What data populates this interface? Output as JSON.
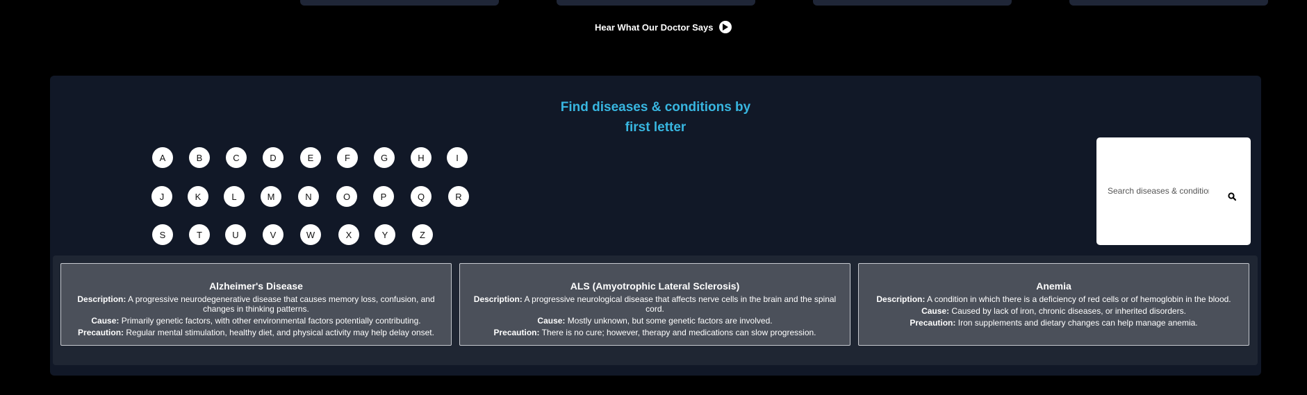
{
  "doctor_link": {
    "label": "Hear What Our Doctor Says",
    "icon": "play-icon"
  },
  "finder": {
    "heading_line1": "Find diseases & conditions by",
    "heading_line2": "first letter",
    "letters": [
      "A",
      "B",
      "C",
      "D",
      "E",
      "F",
      "G",
      "H",
      "I",
      "J",
      "K",
      "L",
      "M",
      "N",
      "O",
      "P",
      "Q",
      "R",
      "S",
      "T",
      "U",
      "V",
      "W",
      "X",
      "Y",
      "Z"
    ]
  },
  "search": {
    "placeholder": "Search diseases & conditions",
    "icon": "search-icon"
  },
  "labels": {
    "description": "Description:",
    "cause": "Cause:",
    "precaution": "Precaution:"
  },
  "diseases": [
    {
      "name": "Alzheimer's Disease",
      "description": "A progressive neurodegenerative disease that causes memory loss, confusion, and changes in thinking patterns.",
      "cause": "Primarily genetic factors, with other environmental factors potentially contributing.",
      "precaution": "Regular mental stimulation, healthy diet, and physical activity may help delay onset."
    },
    {
      "name": "ALS (Amyotrophic Lateral Sclerosis)",
      "description": "A progressive neurological disease that affects nerve cells in the brain and the spinal cord.",
      "cause": "Mostly unknown, but some genetic factors are involved.",
      "precaution": "There is no cure; however, therapy and medications can slow progression."
    },
    {
      "name": "Anemia",
      "description": "A condition in which there is a deficiency of red cells or of hemoglobin in the blood.",
      "cause": "Caused by lack of iron, chronic diseases, or inherited disorders.",
      "precaution": "Iron supplements and dietary changes can help manage anemia."
    }
  ],
  "colors": {
    "accent": "#38b6e0",
    "panel": "#111827",
    "card": "#4b505a"
  }
}
